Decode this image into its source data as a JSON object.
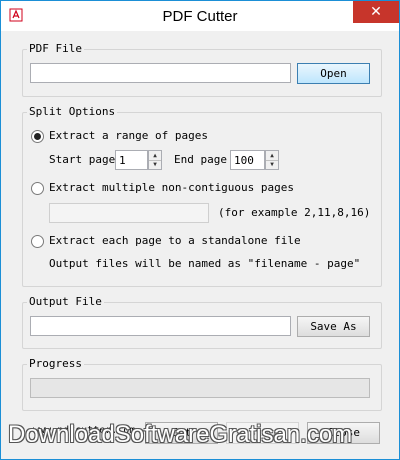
{
  "window": {
    "title": "PDF Cutter",
    "close_glyph": "✕",
    "app_icon": "pdf-app-icon"
  },
  "pdf_file": {
    "group_label": "PDF File",
    "path_value": "",
    "open_label": "Open"
  },
  "split": {
    "group_label": "Split Options",
    "range": {
      "label": "Extract a range of pages",
      "checked": true,
      "start_label": "Start page",
      "start_value": "1",
      "end_label": "End page",
      "end_value": "100"
    },
    "multiple": {
      "label": "Extract multiple non-contiguous pages",
      "checked": false,
      "pages_value": "",
      "hint": "(for example 2,11,8,16)"
    },
    "each": {
      "label": "Extract each page to a standalone file",
      "checked": false,
      "note": "Output files will be named as \"filename - page\""
    }
  },
  "output": {
    "group_label": "Output File",
    "path_value": "",
    "save_as_label": "Save As"
  },
  "progress": {
    "group_label": "Progress",
    "value": 0
  },
  "footer": {
    "website": "www.pdfcutter.com",
    "cut_label": "Cut",
    "stop_label": "Stop",
    "close_label": "Close"
  },
  "watermark": "DownloadSoftwareGratisan.com",
  "colors": {
    "accent_border": "#1b8fd6",
    "close_button": "#c7352b",
    "pdf_icon": "#d0021b",
    "progress_fill": "#06b025"
  }
}
